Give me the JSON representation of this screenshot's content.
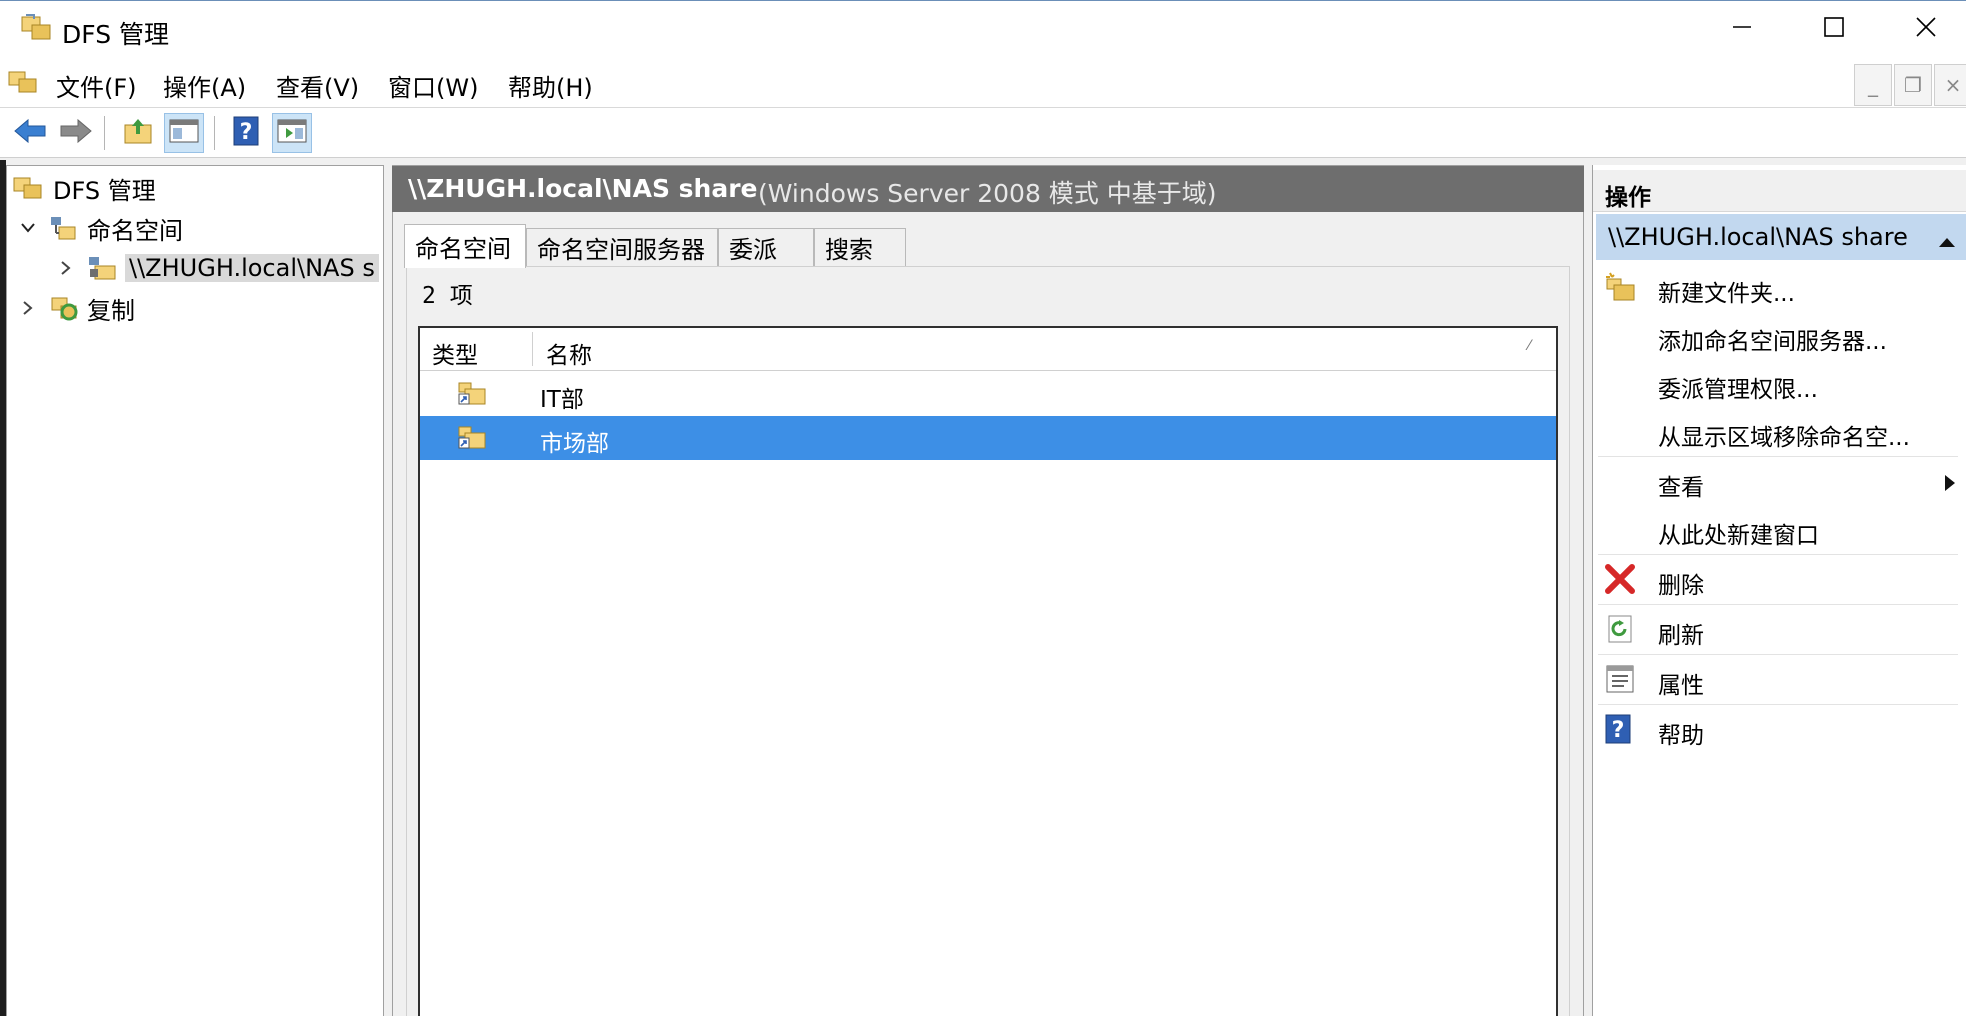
{
  "window": {
    "title": "DFS 管理",
    "controls": {
      "minimize": "minimize-icon",
      "maximize": "maximize-icon",
      "close": "close-icon"
    }
  },
  "menu": {
    "items": [
      {
        "label": "文件(F)"
      },
      {
        "label": "操作(A)"
      },
      {
        "label": "查看(V)"
      },
      {
        "label": "窗口(W)"
      },
      {
        "label": "帮助(H)"
      }
    ],
    "mdi_controls": {
      "minimize": "_",
      "restore": "❐",
      "close": "×"
    }
  },
  "toolbar": {
    "buttons": [
      "back-arrow-icon",
      "forward-arrow-icon",
      "up-folder-icon",
      "show-hide-tree-icon",
      "help-icon",
      "show-hide-action-pane-icon"
    ]
  },
  "tree": {
    "root": {
      "label": "DFS 管理"
    },
    "namespaces": {
      "label": "命名空间"
    },
    "namespace_item": {
      "label": "\\\\ZHUGH.local\\NAS s"
    },
    "replication": {
      "label": "复制"
    }
  },
  "content": {
    "header_title": "\\\\ZHUGH.local\\NAS share",
    "header_subtitle": "(Windows Server 2008 模式 中基于域)",
    "tabs": [
      {
        "label": "命名空间"
      },
      {
        "label": "命名空间服务器"
      },
      {
        "label": "委派"
      },
      {
        "label": "搜索"
      }
    ],
    "item_count": "2 项",
    "columns": [
      {
        "label": "类型"
      },
      {
        "label": "名称"
      }
    ],
    "rows": [
      {
        "name": "IT部",
        "icon": "namespace-folder-icon",
        "selected": false
      },
      {
        "name": "市场部",
        "icon": "namespace-folder-icon",
        "selected": true
      }
    ]
  },
  "actions": {
    "title": "操作",
    "section": "\\\\ZHUGH.local\\NAS share",
    "items": [
      {
        "label": "新建文件夹...",
        "icon": "new-folder-icon"
      },
      {
        "label": "添加命名空间服务器...",
        "icon": ""
      },
      {
        "label": "委派管理权限...",
        "icon": ""
      },
      {
        "label": "从显示区域移除命名空...",
        "icon": ""
      },
      {
        "label": "查看",
        "icon": "",
        "submenu": true
      },
      {
        "label": "从此处新建窗口",
        "icon": ""
      },
      {
        "label": "删除",
        "icon": "delete-icon"
      },
      {
        "label": "刷新",
        "icon": "refresh-icon"
      },
      {
        "label": "属性",
        "icon": "properties-icon"
      },
      {
        "label": "帮助",
        "icon": "help-icon"
      }
    ]
  },
  "colors": {
    "selection": "#3d8fe6",
    "header_bg": "#6e6e6e",
    "action_section_bg": "#c2d8ef"
  }
}
